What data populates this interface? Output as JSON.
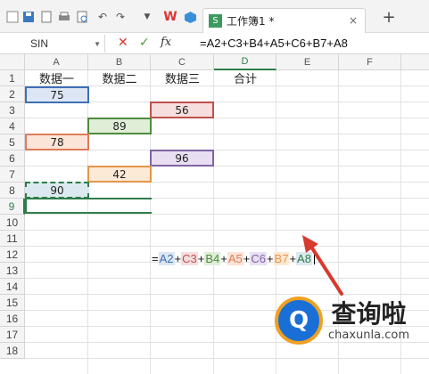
{
  "app": {
    "tab_title": "工作簿1 *"
  },
  "name_box": {
    "value": "SIN"
  },
  "formula_bar": {
    "fx_label": "fx",
    "formula": "=A2+C3+B4+A5+C6+B7+A8"
  },
  "columns": [
    "A",
    "B",
    "C",
    "D",
    "E",
    "F"
  ],
  "rows": [
    "1",
    "2",
    "3",
    "4",
    "5",
    "6",
    "7",
    "8",
    "9",
    "10",
    "11",
    "12",
    "13",
    "14",
    "15",
    "16",
    "17",
    "18"
  ],
  "headers": {
    "A1": "数据一",
    "B1": "数据二",
    "C1": "数据三",
    "D1": "合计"
  },
  "values": {
    "A2": "75",
    "C3": "56",
    "B4": "89",
    "A5": "78",
    "C6": "96",
    "B7": "42",
    "A8": "90"
  },
  "formula_cell": {
    "eq": "=",
    "parts": [
      "A2",
      "C3",
      "B4",
      "A5",
      "C6",
      "B7",
      "A8"
    ],
    "plus": "+"
  },
  "colors": {
    "A2": "#3f6fb5",
    "C3": "#c0504d",
    "B4": "#4f8a3c",
    "A5": "#e07b5a",
    "C6": "#8064a2",
    "B7": "#e5954a",
    "A8": "#2e7d4a",
    "arrow": "#d73a2e"
  },
  "watermark": {
    "cn": "查询啦",
    "en": "chaxunla.com",
    "logo": "Q"
  }
}
